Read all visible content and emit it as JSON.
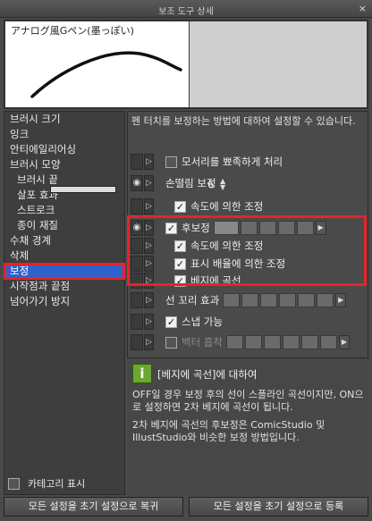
{
  "window": {
    "title": "보조 도구 상세",
    "close_glyph": "×"
  },
  "preview": {
    "brush_name": "アナログ風Gペン(墨っぽい)"
  },
  "categories": [
    {
      "label": "브러시 크기",
      "sub": false
    },
    {
      "label": "잉크",
      "sub": false
    },
    {
      "label": "안티에일리어싱",
      "sub": false
    },
    {
      "label": "브러시 모양",
      "sub": false
    },
    {
      "label": "브러시 끝",
      "sub": true
    },
    {
      "label": "살포 효과",
      "sub": true
    },
    {
      "label": "스트로크",
      "sub": true
    },
    {
      "label": "종이 재질",
      "sub": true
    },
    {
      "label": "수채 경계",
      "sub": false
    },
    {
      "label": "삭제",
      "sub": false
    },
    {
      "label": "보정",
      "sub": false,
      "selected": true
    },
    {
      "label": "시작점과 끝점",
      "sub": false
    },
    {
      "label": "넘어가기 방지",
      "sub": false
    }
  ],
  "category_footer": {
    "label": "카테고리 표시"
  },
  "main": {
    "description": "펜 터치를 보정하는 방법에 대하여 설정할 수 있습니다.",
    "settings": [
      {
        "label": "모서리를 뾰족하게 처리",
        "checked": false
      },
      {
        "label": "손떨림 보정",
        "value": "6"
      },
      {
        "label": "속도에 의한 조정",
        "checked": true
      },
      {
        "label": "후보정",
        "checked": true
      },
      {
        "label": "속도에 의한 조정",
        "checked": true
      },
      {
        "label": "표시 배율에 의한 조정",
        "checked": true
      },
      {
        "label": "베지에 곡선",
        "checked": true
      },
      {
        "label": "선 꼬리 효과"
      },
      {
        "label": "스냅 가능",
        "checked": true
      },
      {
        "label": "벡터 흡착",
        "checked": false
      }
    ]
  },
  "info": {
    "icon": "i",
    "title": "[베지에 곡선]에 대하여",
    "p1": "OFF일 경우 보정 후의 선이 스플라인 곡선이지만, ON으로 설정하면 2차 베지에 곡선이 됩니다.",
    "p2": "2차 베지에 곡선의 후보정은 ComicStudio 및 IllustStudio와 비슷한 보정 방법입니다."
  },
  "buttons": {
    "reset": "모든 설정을 초기 설정으로 복귀",
    "register": "모든 설정을 초기 설정으로 등록"
  },
  "colors": {
    "accent": "#2f63c9",
    "highlight": "#e8222a",
    "info_icon": "#6aa832"
  }
}
